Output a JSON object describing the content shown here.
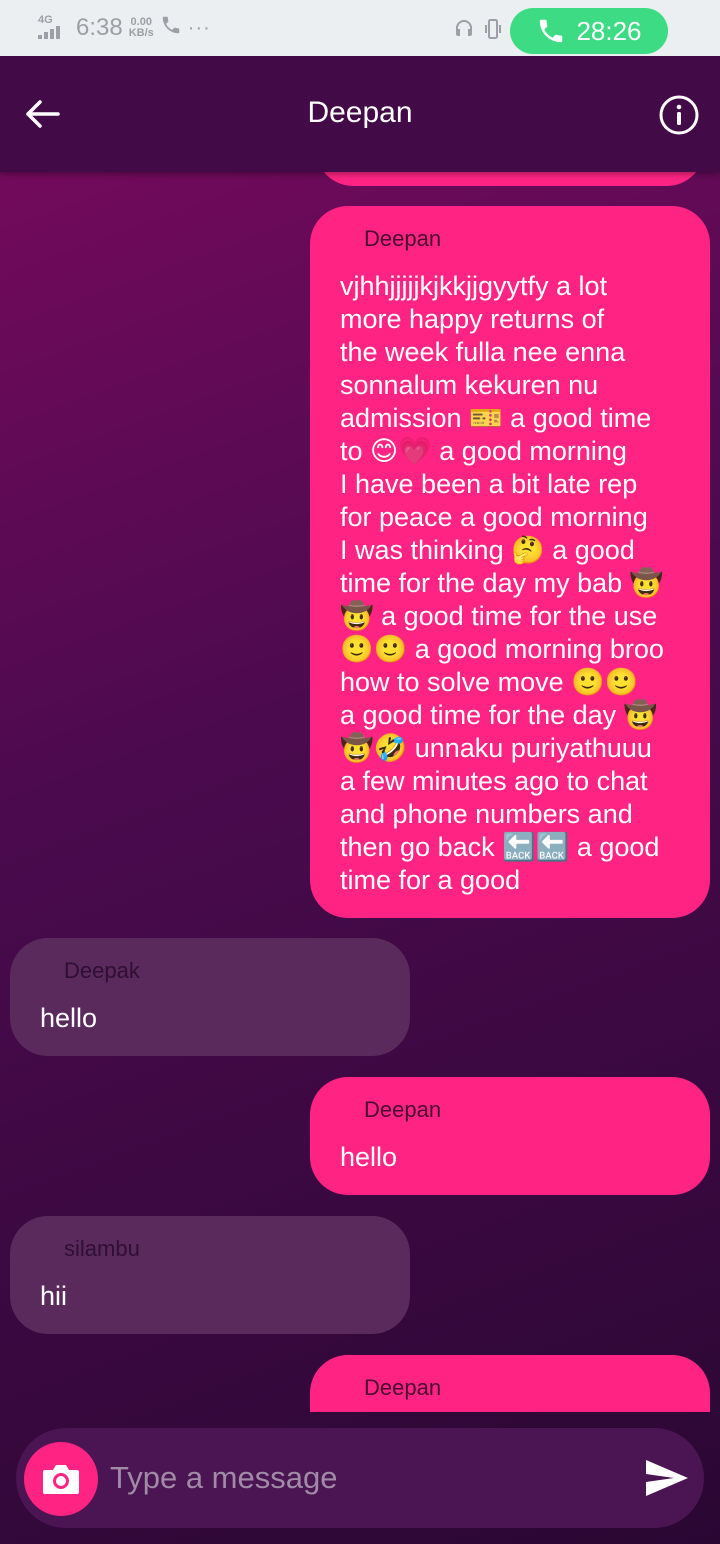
{
  "status_bar": {
    "network": "4G",
    "time": "6:38",
    "net_speed_value": "0.00",
    "net_speed_unit": "KB/s",
    "more": "···",
    "call_timer": "28:26"
  },
  "header": {
    "title": "Deepan",
    "back_icon": "arrow-left-icon",
    "info_icon": "info-icon"
  },
  "messages": [
    {
      "direction": "outgoing",
      "sender": "",
      "text": ""
    },
    {
      "direction": "outgoing",
      "sender": "Deepan",
      "lines": [
        "vjhhjjjjjkjkkjjgyytfy a lot",
        "more happy returns of",
        "the week fulla nee enna",
        "sonnalum kekuren nu",
        "admission 🎫 a good time",
        "to 😊💗 a good morning",
        "I have been a bit late rep",
        "for peace a good morning",
        "I was thinking 🤔 a good",
        "time for the day my bab 🤠",
        "🤠 a good time for the use",
        "🙂🙂 a good morning broo",
        "how to solve move 🙂🙂",
        "a good time for the day 🤠",
        "🤠🤣 unnaku puriyathuuu",
        "a few minutes ago to chat",
        "and phone numbers and",
        "then go back 🔙🔙 a good",
        "time for a good"
      ]
    },
    {
      "direction": "incoming",
      "sender": "Deepak",
      "text": "hello"
    },
    {
      "direction": "outgoing",
      "sender": "Deepan",
      "text": "hello"
    },
    {
      "direction": "incoming",
      "sender": "silambu",
      "text": "hii"
    },
    {
      "direction": "outgoing",
      "sender": "Deepan",
      "text": ""
    }
  ],
  "composer": {
    "placeholder": "Type a message",
    "camera_icon": "camera-icon",
    "send_icon": "send-icon"
  },
  "colors": {
    "outgoing_bubble": "#ff2483",
    "incoming_bubble": "#5a2a5c",
    "header": "#420a47",
    "call_pill": "#3ddc84"
  }
}
